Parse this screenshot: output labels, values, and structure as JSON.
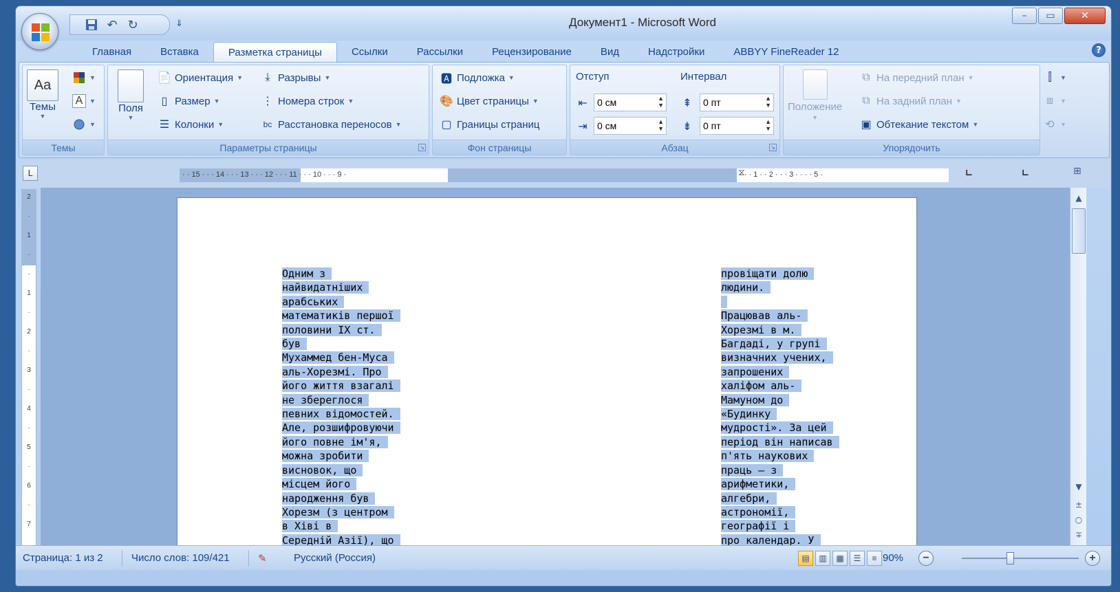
{
  "window": {
    "title": "Документ1 - Microsoft Word",
    "controls": {
      "minimize": "–",
      "maximize": "▭",
      "close": "✕"
    }
  },
  "quick_access": {
    "items": [
      "save-icon",
      "undo-icon",
      "redo-icon"
    ],
    "more": "⇓"
  },
  "tabs": [
    {
      "label": "Главная",
      "active": false
    },
    {
      "label": "Вставка",
      "active": false
    },
    {
      "label": "Разметка страницы",
      "active": true
    },
    {
      "label": "Ссылки",
      "active": false
    },
    {
      "label": "Рассылки",
      "active": false
    },
    {
      "label": "Рецензирование",
      "active": false
    },
    {
      "label": "Вид",
      "active": false
    },
    {
      "label": "Надстройки",
      "active": false
    },
    {
      "label": "ABBYY FineReader 12",
      "active": false
    }
  ],
  "ribbon": {
    "themes": {
      "label": "Темы",
      "button": "Темы"
    },
    "page_setup": {
      "label": "Параметры страницы",
      "margins": "Поля",
      "orientation": "Ориентация",
      "size": "Размер",
      "columns": "Колонки",
      "breaks": "Разрывы",
      "line_numbers": "Номера строк",
      "hyphenation": "Расстановка переносов"
    },
    "page_background": {
      "label": "Фон страницы",
      "watermark": "Подложка",
      "page_color": "Цвет страницы",
      "page_borders": "Границы страниц"
    },
    "paragraph": {
      "label": "Абзац",
      "indent_title": "Отступ",
      "spacing_title": "Интервал",
      "indent_left": "0 см",
      "indent_right": "0 см",
      "spacing_before": "0 пт",
      "spacing_after": "0 пт"
    },
    "arrange": {
      "label": "Упорядочить",
      "position": "Положение",
      "bring_front": "На передний план",
      "send_back": "На задний план",
      "text_wrapping": "Обтекание текстом"
    }
  },
  "ruler": {
    "left_ticks": "· · 15 · · · 14 · · · 13 · · · 12 · · · 11 · · · 10 · · · 9 ·",
    "right_ticks": "· · · 1 · · 2 · · · 3 · · · · 5 ·",
    "vertical_ticks": [
      "2",
      "·",
      "1",
      "·",
      "·",
      "1",
      "·",
      "2",
      "·",
      "3",
      "·",
      "4",
      "·",
      "5",
      "·",
      "6",
      "·",
      "7"
    ]
  },
  "document": {
    "column_left": [
      "Одним з",
      "найвидатніших",
      "арабських",
      "математиків першої",
      "половини IX ст.",
      "був",
      "Мухаммед бен-Муса",
      "аль-Хорезмі. Про",
      "його життя взагалі",
      "не збереглося",
      "певних відомостей.",
      "Але, розшифровуючи",
      "його повне ім'я,",
      "можна зробити",
      "висновок, що",
      "місцем його",
      "народження був",
      "Хорезм (з центром",
      "в Хіві в",
      "Середній Азії), що"
    ],
    "column_right": [
      "провіщати долю",
      "людини.",
      "",
      "Працював аль-",
      "Хорезмі в м.",
      "Багдаді, у групі",
      "визначних учених,",
      "запрошених",
      "халіфом аль-",
      "Мамуном до",
      "«Будинку",
      "мудрості». За цей",
      "період він написав",
      "п'ять наукових",
      "праць — з",
      "арифметики,",
      "алгебри,",
      "астрономії,",
      "географії і",
      "про календар. У"
    ]
  },
  "statusbar": {
    "page": "Страница: 1 из 2",
    "words": "Число слов: 109/421",
    "language": "Русский (Россия)",
    "zoom": "90%",
    "zoom_minus": "−",
    "zoom_plus": "+"
  }
}
